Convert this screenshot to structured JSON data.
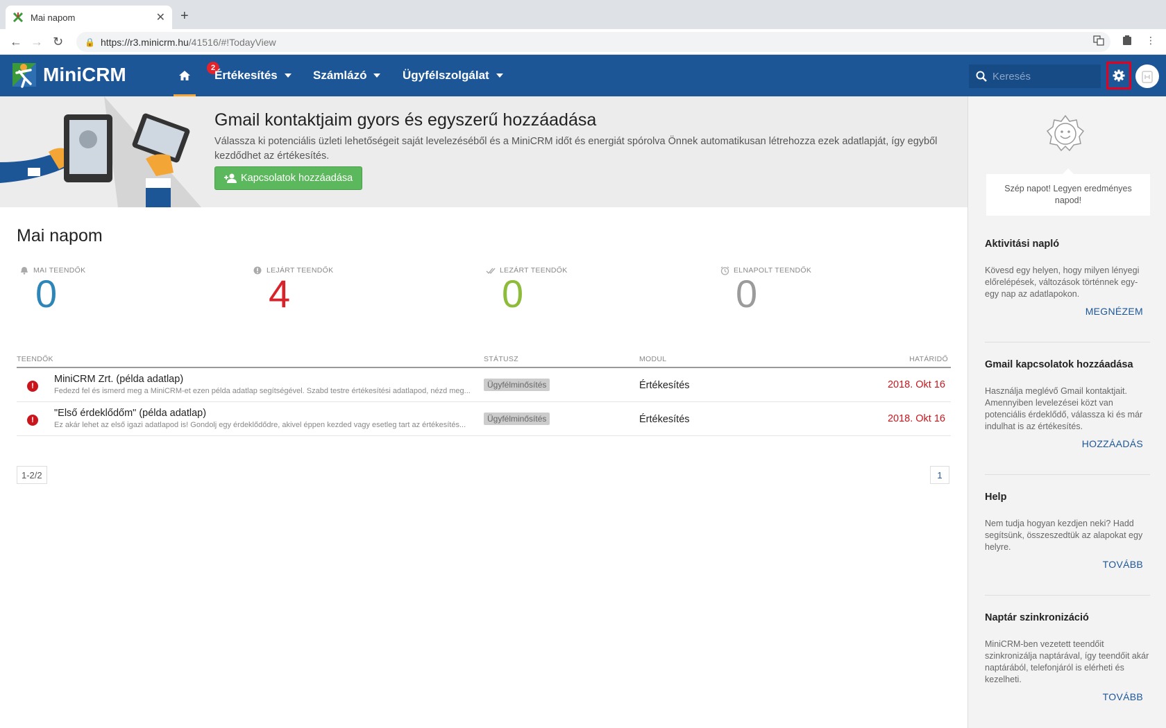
{
  "browser": {
    "tab_title": "Mai napom",
    "url_host": "https://r3.minicrm.hu",
    "url_path": "/41516/#!TodayView"
  },
  "header": {
    "logo_text": "MiniCRM",
    "nav": [
      {
        "label": "Értékesítés",
        "badge": "2"
      },
      {
        "label": "Számlázó"
      },
      {
        "label": "Ügyfélszolgálat"
      }
    ],
    "search_placeholder": "Keresés"
  },
  "banner": {
    "title": "Gmail kontaktjaim gyors és egyszerű hozzáadása",
    "text": "Válassza ki potenciális üzleti lehetőségeit saját levelezéséből és a MiniCRM időt és energiát spórolva Önnek automatikusan létrehozza ezek adatlapját, így egyből kezdődhet az értékesítés.",
    "button": "Kapcsolatok hozzáadása"
  },
  "main": {
    "title": "Mai napom",
    "stats": [
      {
        "label": "MAI TEENDŐK",
        "value": "0",
        "color": "#2e86b8"
      },
      {
        "label": "LEJÁRT TEENDŐK",
        "value": "4",
        "color": "#d9232a"
      },
      {
        "label": "LEZÁRT TEENDŐK",
        "value": "0",
        "color": "#8dbb3a"
      },
      {
        "label": "ELNAPOLT TEENDŐK",
        "value": "0",
        "color": "#9b9b9b"
      }
    ],
    "table": {
      "headers": {
        "tasks": "TEENDŐK",
        "status": "STÁTUSZ",
        "module": "MODUL",
        "deadline": "HATÁRIDŐ"
      },
      "rows": [
        {
          "title": "MiniCRM Zrt. (példa adatlap)",
          "desc": "Fedezd fel és ismerd meg a MiniCRM-et ezen példa adatlap segítségével. Szabd testre értékesítési adatlapod, nézd meg...",
          "status": "Ügyfélminősítés",
          "module": "Értékesítés",
          "deadline": "2018. Okt 16"
        },
        {
          "title": "\"Első érdeklődőm\" (példa adatlap)",
          "desc": "Ez akár lehet az első igazi adatlapod is! Gondolj egy érdeklődődre, akivel éppen kezded vagy esetleg tart az értékesítés...",
          "status": "Ügyfélminősítés",
          "module": "Értékesítés",
          "deadline": "2018. Okt 16"
        }
      ]
    },
    "pager_count": "1-2/2",
    "pager_page": "1"
  },
  "sidebar": {
    "greeting": "Szép napot! Legyen eredményes napod!",
    "sections": [
      {
        "title": "Aktivitási napló",
        "text": "Kövesd egy helyen, hogy milyen lényegi előrelépések, változások történnek egy-egy nap az adatlapokon.",
        "link": "MEGNÉZEM"
      },
      {
        "title": "Gmail kapcsolatok hozzáadása",
        "text": "Használja meglévő Gmail kontaktjait. Amennyiben levelezései közt van potenciális érdeklődő, válassza ki és már indulhat is az értékesítés.",
        "link": "HOZZÁADÁS"
      },
      {
        "title": "Help",
        "text": "Nem tudja hogyan kezdjen neki? Hadd segítsünk, összeszedtük az alapokat egy helyre.",
        "link": "TOVÁBB"
      },
      {
        "title": "Naptár szinkronizáció",
        "text": "MiniCRM-ben vezetett teendőit szinkronizálja naptárával, így teendőit akár naptárából, telefonjáról is elérheti és kezelheti.",
        "link": "TOVÁBB"
      }
    ]
  }
}
